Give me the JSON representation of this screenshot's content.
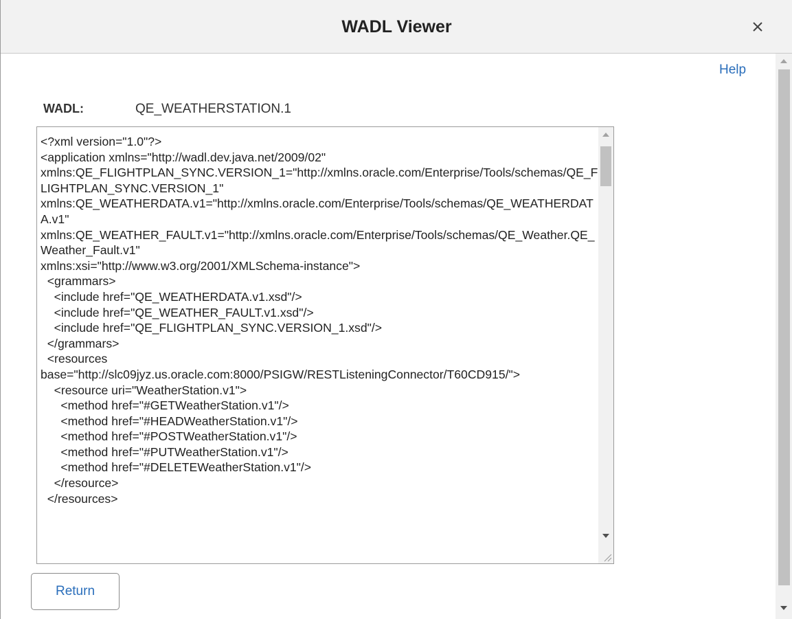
{
  "dialog": {
    "title": "WADL Viewer",
    "close_icon": "close-icon"
  },
  "toolbar": {
    "help_label": "Help"
  },
  "wadl": {
    "label": "WADL:",
    "value": "QE_WEATHERSTATION.1"
  },
  "editor": {
    "content": "<?xml version=\"1.0\"?>\n<application xmlns=\"http://wadl.dev.java.net/2009/02\"\nxmlns:QE_FLIGHTPLAN_SYNC.VERSION_1=\"http://xmlns.oracle.com/Enterprise/Tools/schemas/QE_FLIGHTPLAN_SYNC.VERSION_1\"\nxmlns:QE_WEATHERDATA.v1=\"http://xmlns.oracle.com/Enterprise/Tools/schemas/QE_WEATHERDATA.v1\"\nxmlns:QE_WEATHER_FAULT.v1=\"http://xmlns.oracle.com/Enterprise/Tools/schemas/QE_Weather.QE_Weather_Fault.v1\"\nxmlns:xsi=\"http://www.w3.org/2001/XMLSchema-instance\">\n  <grammars>\n    <include href=\"QE_WEATHERDATA.v1.xsd\"/>\n    <include href=\"QE_WEATHER_FAULT.v1.xsd\"/>\n    <include href=\"QE_FLIGHTPLAN_SYNC.VERSION_1.xsd\"/>\n  </grammars>\n  <resources\nbase=\"http://slc09jyz.us.oracle.com:8000/PSIGW/RESTListeningConnector/T60CD915/\">\n    <resource uri=\"WeatherStation.v1\">\n      <method href=\"#GETWeatherStation.v1\"/>\n      <method href=\"#HEADWeatherStation.v1\"/>\n      <method href=\"#POSTWeatherStation.v1\"/>\n      <method href=\"#PUTWeatherStation.v1\"/>\n      <method href=\"#DELETEWeatherStation.v1\"/>\n    </resource>\n  </resources>"
  },
  "actions": {
    "return_label": "Return"
  },
  "colors": {
    "link": "#2a6ebb",
    "title_bar": "#f2f2f2",
    "text": "#222222"
  }
}
